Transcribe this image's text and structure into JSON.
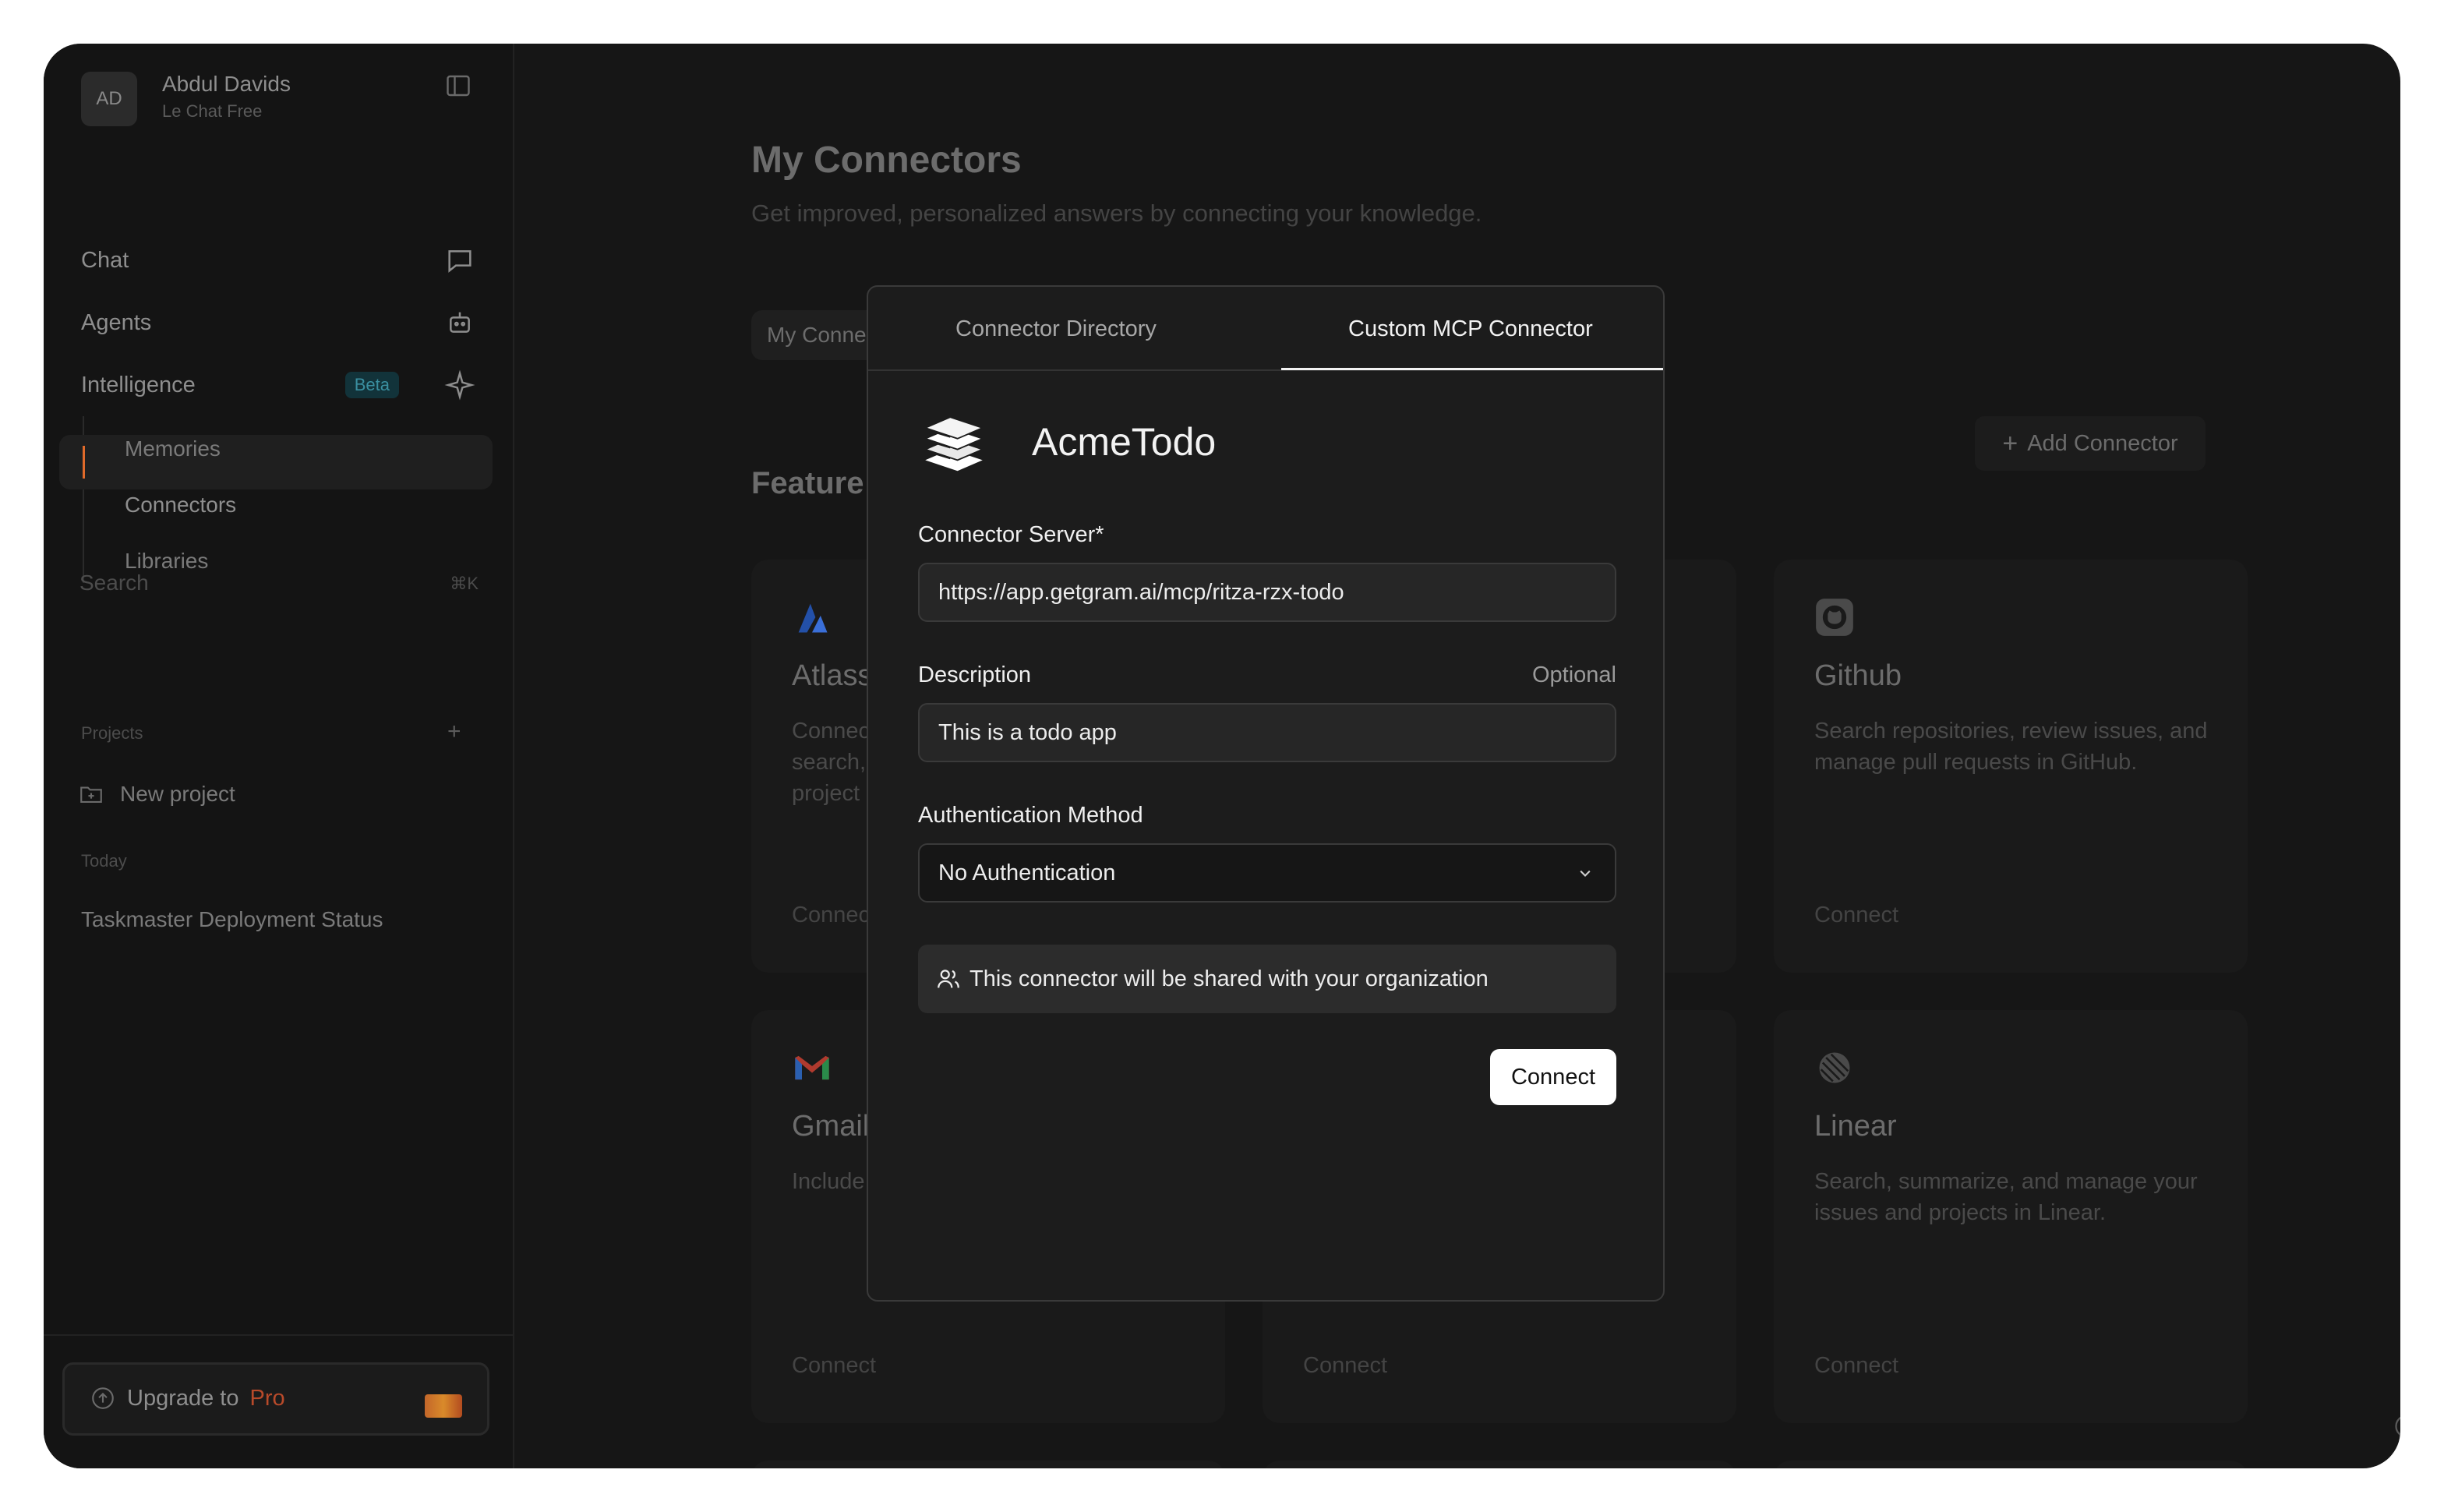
{
  "user": {
    "initials": "AD",
    "name": "Abdul Davids",
    "plan": "Le Chat Free"
  },
  "nav": {
    "chat": "Chat",
    "agents": "Agents",
    "intelligence": "Intelligence",
    "beta": "Beta",
    "sub_items": [
      "Memories",
      "Connectors",
      "Libraries"
    ],
    "search": "Search",
    "search_shortcut": "⌘K"
  },
  "projects": {
    "label": "Projects",
    "new_project": "New project"
  },
  "history": {
    "section": "Today",
    "items": [
      "Taskmaster Deployment Status"
    ]
  },
  "upgrade": {
    "text": "Upgrade to",
    "pro": "Pro"
  },
  "main": {
    "title": "My Connectors",
    "subtitle": "Get improved, personalized answers by connecting your knowledge.",
    "filter_pill": "My Conne",
    "featured_title": "Feature",
    "add_connector": "Add Connector"
  },
  "cards": [
    {
      "name": "Atlass",
      "desc": "Connec\nsearch,\nproject",
      "connect": "Connec",
      "icon": "atlassian-icon"
    },
    {
      "name": "Github",
      "desc": "Search repositories, review issues, and manage pull requests in GitHub.",
      "connect": "Connect",
      "icon": "github-icon"
    },
    {
      "name": "Gmail",
      "desc": "Include",
      "connect": "Connect",
      "icon": "gmail-icon"
    },
    {
      "name": "",
      "desc": ".",
      "connect": "Connect",
      "icon": ""
    },
    {
      "name": "Linear",
      "desc": "Search, summarize, and manage your issues and projects in Linear.",
      "connect": "Connect",
      "icon": "linear-icon"
    }
  ],
  "modal": {
    "tabs": {
      "directory": "Connector Directory",
      "custom": "Custom MCP Connector"
    },
    "connector_name": "AcmeTodo",
    "server_label": "Connector Server*",
    "server_value": "https://app.getgram.ai/mcp/ritza-rzx-todo",
    "description_label": "Description",
    "optional": "Optional",
    "description_value": "This is a todo app",
    "auth_label": "Authentication Method",
    "auth_value": "No Authentication",
    "shared_note": "This connector will be shared with your organization",
    "connect_button": "Connect"
  },
  "colors": {
    "app_bg": "#161616",
    "modal_bg": "#1c1c1c",
    "accent_orange": "#e06a2a",
    "beta_text": "#3a8fa0",
    "primary_button": "#ffffff"
  }
}
